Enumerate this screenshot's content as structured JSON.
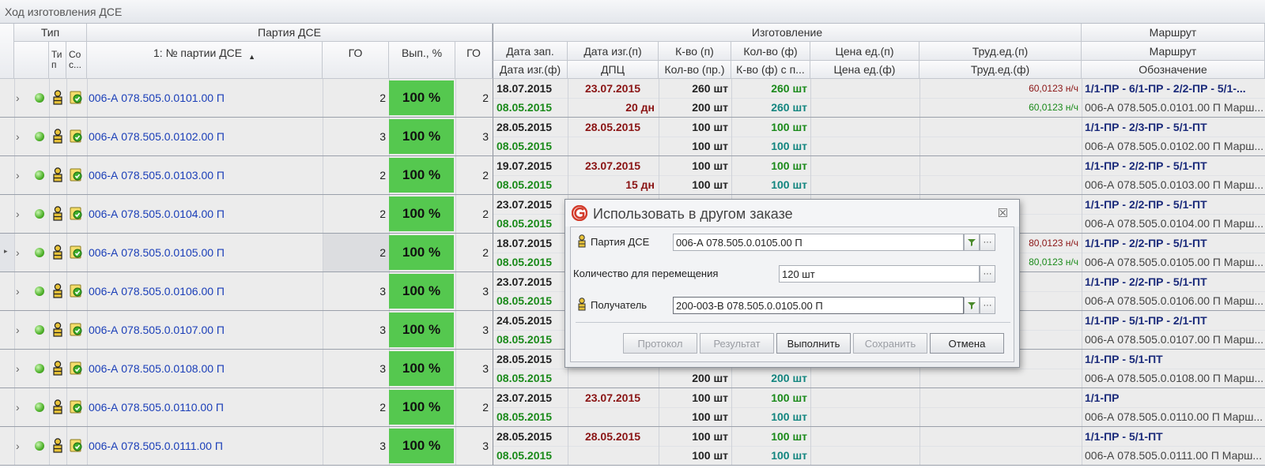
{
  "window": {
    "title": "Ход изготовления ДСЕ"
  },
  "header": {
    "group_type": "Тип",
    "group_batch": "Партия ДСЕ",
    "group_manuf": "Изготовление",
    "group_route": "Маршрут",
    "col_type": "Ти п",
    "col_state": "Со с...",
    "col_batch_no": "1: № партии ДСЕ",
    "col_go": "ГО",
    "col_pct": "Вып., %",
    "col_go2": "ГО",
    "col_date_zap": "Дата зап.",
    "col_date_izg_p": "Дата изг.(п)",
    "col_qty_p": "К-во (п)",
    "col_qty_f": "Кол-во (ф)",
    "col_price_p": "Цена ед.(п)",
    "col_labor_p": "Труд.ед.(п)",
    "col_route": "Маршрут",
    "col_date_izg_f": "Дата изг.(ф)",
    "col_dpc": "ДПЦ",
    "col_qty_pr": "Кол-во (пр.)",
    "col_qty_fs": "К-во (ф) с п...",
    "col_price_f": "Цена ед.(ф)",
    "col_labor_f": "Труд.ед.(ф)",
    "col_designation": "Обозначение"
  },
  "rows": [
    {
      "batch": "006-А 078.505.0.0101.00 П",
      "go": "2",
      "pct": "100 %",
      "go2": "2",
      "date_zap": "18.07.2015",
      "date_izg_p": "23.07.2015",
      "qty_p": "260 шт",
      "qty_f": "260 шт",
      "labor_p": "60,0123 н/ч",
      "route": "1/1-ПР - 6/1-ПР - 2/2-ПР - 5/1-...",
      "date_izg_f": "08.05.2015",
      "dpc": "20 дн",
      "qty_pr": "200 шт",
      "qty_fs": "260 шт",
      "labor_f": "60,0123 н/ч",
      "designation": "006-А 078.505.0.0101.00 П Марш..."
    },
    {
      "batch": "006-А 078.505.0.0102.00 П",
      "go": "3",
      "pct": "100 %",
      "go2": "3",
      "date_zap": "28.05.2015",
      "date_izg_p": "28.05.2015",
      "qty_p": "100 шт",
      "qty_f": "100 шт",
      "labor_p": "",
      "route": "1/1-ПР - 2/3-ПР - 5/1-ПТ",
      "date_izg_f": "08.05.2015",
      "dpc": "",
      "qty_pr": "100 шт",
      "qty_fs": "100 шт",
      "labor_f": "",
      "designation": "006-А 078.505.0.0102.00 П Марш..."
    },
    {
      "batch": "006-А 078.505.0.0103.00 П",
      "go": "2",
      "pct": "100 %",
      "go2": "2",
      "date_zap": "19.07.2015",
      "date_izg_p": "23.07.2015",
      "qty_p": "100 шт",
      "qty_f": "100 шт",
      "labor_p": "",
      "route": "1/1-ПР - 2/2-ПР - 5/1-ПТ",
      "date_izg_f": "08.05.2015",
      "dpc": "15 дн",
      "qty_pr": "100 шт",
      "qty_fs": "100 шт",
      "labor_f": "",
      "designation": "006-А 078.505.0.0103.00 П Марш..."
    },
    {
      "batch": "006-А 078.505.0.0104.00 П",
      "go": "2",
      "pct": "100 %",
      "go2": "2",
      "date_zap": "23.07.2015",
      "date_izg_p": "",
      "qty_p": "",
      "qty_f": "",
      "labor_p": "",
      "route": "1/1-ПР - 2/2-ПР - 5/1-ПТ",
      "date_izg_f": "08.05.2015",
      "dpc": "",
      "qty_pr": "",
      "qty_fs": "",
      "labor_f": "",
      "designation": "006-А 078.505.0.0104.00 П Марш..."
    },
    {
      "batch": "006-А 078.505.0.0105.00 П",
      "go": "2",
      "pct": "100 %",
      "go2": "2",
      "date_zap": "18.07.2015",
      "date_izg_p": "",
      "qty_p": "",
      "qty_f": "",
      "labor_p": "80,0123 н/ч",
      "route": "1/1-ПР - 2/2-ПР - 5/1-ПТ",
      "date_izg_f": "08.05.2015",
      "dpc": "",
      "qty_pr": "",
      "qty_fs": "",
      "labor_f": "80,0123 н/ч",
      "designation": "006-А 078.505.0.0105.00 П Марш..."
    },
    {
      "batch": "006-А 078.505.0.0106.00 П",
      "go": "3",
      "pct": "100 %",
      "go2": "3",
      "date_zap": "23.07.2015",
      "date_izg_p": "",
      "qty_p": "",
      "qty_f": "",
      "labor_p": "",
      "route": "1/1-ПР - 2/2-ПР - 5/1-ПТ",
      "date_izg_f": "08.05.2015",
      "dpc": "",
      "qty_pr": "",
      "qty_fs": "",
      "labor_f": "",
      "designation": "006-А 078.505.0.0106.00 П Марш..."
    },
    {
      "batch": "006-А 078.505.0.0107.00 П",
      "go": "3",
      "pct": "100 %",
      "go2": "3",
      "date_zap": "24.05.2015",
      "date_izg_p": "",
      "qty_p": "",
      "qty_f": "",
      "labor_p": "",
      "route": "1/1-ПР - 5/1-ПР - 2/1-ПТ",
      "date_izg_f": "08.05.2015",
      "dpc": "",
      "qty_pr": "",
      "qty_fs": "",
      "labor_f": "",
      "designation": "006-А 078.505.0.0107.00 П Марш..."
    },
    {
      "batch": "006-А 078.505.0.0108.00 П",
      "go": "3",
      "pct": "100 %",
      "go2": "3",
      "date_zap": "28.05.2015",
      "date_izg_p": "",
      "qty_p": "",
      "qty_f": "",
      "labor_p": "",
      "route": "1/1-ПР - 5/1-ПТ",
      "date_izg_f": "08.05.2015",
      "dpc": "",
      "qty_pr": "200 шт",
      "qty_fs": "200 шт",
      "labor_f": "",
      "designation": "006-А 078.505.0.0108.00 П Марш..."
    },
    {
      "batch": "006-А 078.505.0.0110.00 П",
      "go": "2",
      "pct": "100 %",
      "go2": "2",
      "date_zap": "23.07.2015",
      "date_izg_p": "23.07.2015",
      "qty_p": "100 шт",
      "qty_f": "100 шт",
      "labor_p": "",
      "route": "1/1-ПР",
      "date_izg_f": "08.05.2015",
      "dpc": "",
      "qty_pr": "100 шт",
      "qty_fs": "100 шт",
      "labor_f": "",
      "designation": "006-А 078.505.0.0110.00 П Марш..."
    },
    {
      "batch": "006-А 078.505.0.0111.00 П",
      "go": "3",
      "pct": "100 %",
      "go2": "3",
      "date_zap": "28.05.2015",
      "date_izg_p": "28.05.2015",
      "qty_p": "100 шт",
      "qty_f": "100 шт",
      "labor_p": "",
      "route": "1/1-ПР - 5/1-ПТ",
      "date_izg_f": "08.05.2015",
      "dpc": "",
      "qty_pr": "100 шт",
      "qty_fs": "100 шт",
      "labor_f": "",
      "designation": "006-А 078.505.0.0111.00 П Марш..."
    }
  ],
  "dialog": {
    "title": "Использовать в другом заказе",
    "close_glyph": "☒",
    "batch_label": "Партия ДСЕ",
    "batch_value": "006-А 078.505.0.0105.00 П",
    "qty_label": "Количество для перемещения",
    "qty_value": "120 шт",
    "recipient_label": "Получатель",
    "recipient_value": "200-003-В 078.505.0.0105.00 П",
    "ellipsis": "···",
    "btn_protocol": "Протокол",
    "btn_result": "Результат",
    "btn_execute": "Выполнить",
    "btn_save": "Сохранить",
    "btn_cancel": "Отмена"
  },
  "colors": {
    "pct_fill": "#55c84f",
    "link": "#1a3eb8",
    "date_plan": "#8a1414",
    "date_fact": "#1a8a1a",
    "qty_fact": "#12857f",
    "route": "#1a2a7a"
  }
}
